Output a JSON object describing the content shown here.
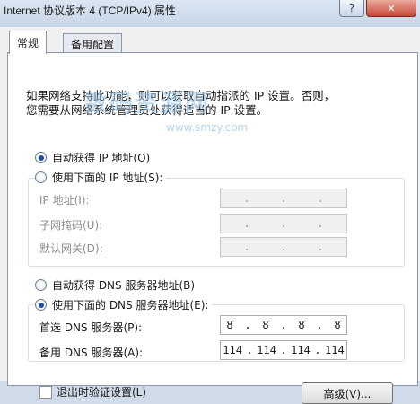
{
  "window": {
    "title": "Internet 协议版本 4 (TCP/IPv4) 属性",
    "help_label": "?",
    "close_label": "✕"
  },
  "tabs": [
    {
      "label": "常规"
    },
    {
      "label": "备用配置"
    }
  ],
  "description": {
    "line1": "如果网络支持此功能，则可以获取自动指派的 IP 设置。否则，",
    "line2": "您需要从网络系统管理员处获得适当的 IP 设置。"
  },
  "watermark": {
    "text": "数码资源网",
    "sub": "www.smzy.com"
  },
  "ip_section": {
    "auto_label": "自动获得 IP 地址(O)",
    "manual_label": "使用下面的 IP 地址(S):",
    "auto_selected": true,
    "fields": [
      {
        "label": "IP 地址(I):",
        "octets": [
          "",
          "",
          "",
          ""
        ]
      },
      {
        "label": "子网掩码(U):",
        "octets": [
          "",
          "",
          "",
          ""
        ]
      },
      {
        "label": "默认网关(D):",
        "octets": [
          "",
          "",
          "",
          ""
        ]
      }
    ]
  },
  "dns_section": {
    "auto_label": "自动获得 DNS 服务器地址(B)",
    "manual_label": "使用下面的 DNS 服务器地址(E):",
    "manual_selected": true,
    "preferred": {
      "label": "首选 DNS 服务器(P):",
      "octets": [
        "8",
        "8",
        "8",
        "8"
      ]
    },
    "alternate": {
      "label": "备用 DNS 服务器(A):",
      "octets": [
        "114",
        "114",
        "114",
        "114"
      ]
    }
  },
  "footer": {
    "validate_label": "退出时验证设置(L)",
    "validate_checked": false,
    "advanced_label": "高级(V)..."
  }
}
